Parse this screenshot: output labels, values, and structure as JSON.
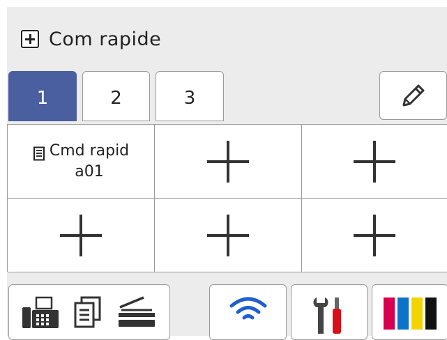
{
  "header": {
    "title": "Com rapide",
    "add_icon": "add-square-icon"
  },
  "tabs": [
    {
      "label": "1",
      "active": true
    },
    {
      "label": "2",
      "active": false
    },
    {
      "label": "3",
      "active": false
    }
  ],
  "edit_icon": "pencil-icon",
  "shortcuts": [
    {
      "type": "shortcut",
      "line1": "Cmd rapid",
      "line2": "a01",
      "icon": "document-icon"
    },
    {
      "type": "add",
      "icon": "plus-icon"
    },
    {
      "type": "add",
      "icon": "plus-icon"
    },
    {
      "type": "add",
      "icon": "plus-icon"
    },
    {
      "type": "add",
      "icon": "plus-icon"
    },
    {
      "type": "add",
      "icon": "plus-icon"
    }
  ],
  "bottom_bar": {
    "mode_icons": [
      "fax-icon",
      "copy-icon",
      "scan-icon"
    ],
    "wifi_icon": "wifi-icon",
    "tools_icon": "wrench-screwdriver-icon",
    "toner_icon": "toner-icon"
  },
  "colors": {
    "active_tab": "#4a5fa0",
    "wifi": "#1f5fd0",
    "toner_magenta": "#d6004e",
    "toner_cyan": "#0d72c9",
    "toner_yellow": "#f4d400",
    "toner_black": "#111111",
    "screwdriver_red": "#d8101a"
  }
}
